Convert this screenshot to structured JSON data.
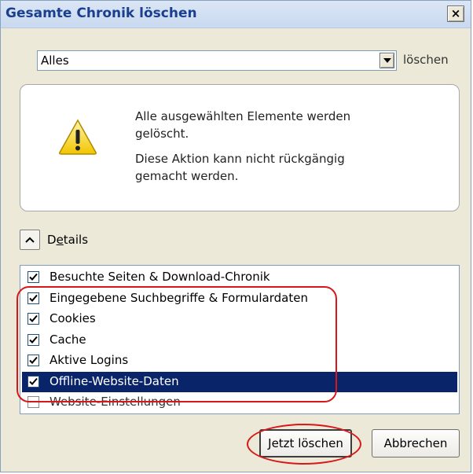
{
  "window": {
    "title": "Gesamte Chronik löschen",
    "close_glyph": "×"
  },
  "range": {
    "selected": "Alles",
    "suffix": "löschen"
  },
  "warning": {
    "icon": "warning-triangle-icon",
    "line1": "Alle ausgewählten Elemente werden gelöscht.",
    "line2": "Diese Aktion kann nicht rückgängig gemacht werden."
  },
  "details": {
    "toggle_icon": "chevron-up-icon",
    "label_mnemonic": "e",
    "label_before": "D",
    "label_after": "tails"
  },
  "items": [
    {
      "label": "Besuchte Seiten & Download-Chronik",
      "checked": true,
      "selected": false
    },
    {
      "label": "Eingegebene Suchbegriffe & Formulardaten",
      "checked": true,
      "selected": false
    },
    {
      "label": "Cookies",
      "checked": true,
      "selected": false
    },
    {
      "label": "Cache",
      "checked": true,
      "selected": false
    },
    {
      "label": "Aktive Logins",
      "checked": true,
      "selected": false
    },
    {
      "label": "Offline-Website-Daten",
      "checked": true,
      "selected": true
    },
    {
      "label": "Website-Einstellungen",
      "checked": false,
      "selected": false
    }
  ],
  "buttons": {
    "confirm": "Jetzt löschen",
    "cancel": "Abbrechen"
  },
  "colors": {
    "highlight_annotation": "#d81818",
    "selection": "#0a246a",
    "title_text": "#1a3f8f"
  }
}
